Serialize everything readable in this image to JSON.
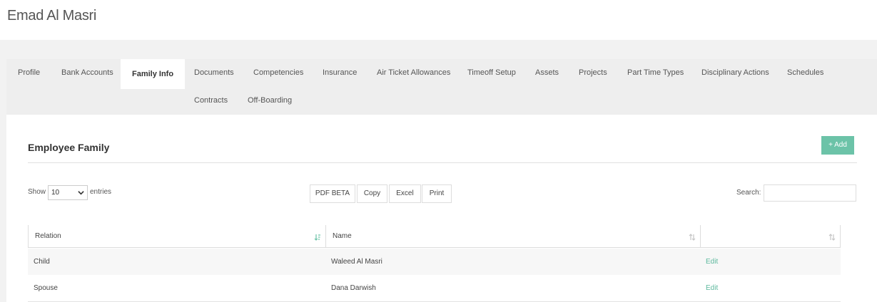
{
  "header": {
    "title": "Emad Al Masri"
  },
  "tabs": [
    {
      "label": "Profile",
      "active": false
    },
    {
      "label": "Bank Accounts",
      "active": false
    },
    {
      "label": "Family Info",
      "active": true
    },
    {
      "label": "Documents",
      "active": false
    },
    {
      "label": "Competencies",
      "active": false
    },
    {
      "label": "Insurance",
      "active": false
    },
    {
      "label": "Air Ticket Allowances",
      "active": false
    },
    {
      "label": "Timeoff Setup",
      "active": false
    },
    {
      "label": "Assets",
      "active": false
    },
    {
      "label": "Projects",
      "active": false
    },
    {
      "label": "Part Time Types",
      "active": false
    },
    {
      "label": "Disciplinary Actions",
      "active": false
    },
    {
      "label": "Schedules",
      "active": false
    },
    {
      "label": "Contracts",
      "active": false
    },
    {
      "label": "Off-Boarding",
      "active": false
    }
  ],
  "section": {
    "title": "Employee Family",
    "add_label": "+ Add"
  },
  "controls": {
    "show_label": "Show",
    "length_value": "10",
    "entries_label": "entries",
    "buttons": [
      "PDF BETA",
      "Copy",
      "Excel",
      "Print"
    ],
    "search_label": "Search:",
    "search_value": ""
  },
  "table": {
    "columns": [
      "Relation",
      "Name",
      ""
    ],
    "rows": [
      {
        "relation": "Child",
        "name": "Waleed Al Masri",
        "action": "Edit"
      },
      {
        "relation": "Spouse",
        "name": "Dana Darwish",
        "action": "Edit"
      }
    ]
  },
  "colors": {
    "accent": "#6cc3a8",
    "link": "#5cb89d",
    "tabbar": "#eeeeee",
    "row_stripe": "#f7f7f7"
  }
}
